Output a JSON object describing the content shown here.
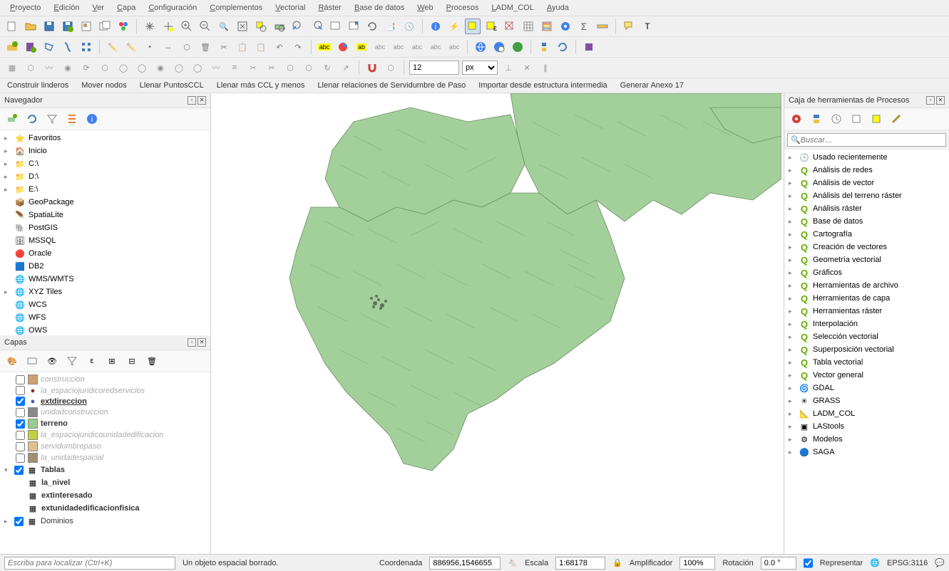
{
  "menu": [
    "Proyecto",
    "Edición",
    "Ver",
    "Capa",
    "Configuración",
    "Complementos",
    "Vectorial",
    "Ráster",
    "Base de datos",
    "Web",
    "Procesos",
    "LADM_COL",
    "Ayuda"
  ],
  "custom_toolbar": [
    "Construir linderos",
    "Mover nodos",
    "Llenar PuntosCCL",
    "Llenar más CCL y menos",
    "Llenar relaciones de Servidumbre de Paso",
    "Importar desde estructura intermedia",
    "Generar Anexo 17"
  ],
  "spin_value": "12",
  "unit": "px",
  "navigator": {
    "title": "Navegador",
    "items": [
      {
        "icon": "star",
        "label": "Favoritos",
        "color": "#f0c040",
        "expand": true
      },
      {
        "icon": "home",
        "label": "Inicio",
        "expand": true
      },
      {
        "icon": "drive",
        "label": "C:\\",
        "expand": true
      },
      {
        "icon": "drive",
        "label": "D:\\",
        "expand": true
      },
      {
        "icon": "drive",
        "label": "E:\\",
        "expand": true
      },
      {
        "icon": "gpkg",
        "label": "GeoPackage"
      },
      {
        "icon": "feather",
        "label": "SpatiaLite"
      },
      {
        "icon": "elephant",
        "label": "PostGIS"
      },
      {
        "icon": "mssql",
        "label": "MSSQL"
      },
      {
        "icon": "oracle",
        "label": "Oracle"
      },
      {
        "icon": "db2",
        "label": "DB2"
      },
      {
        "icon": "globe",
        "label": "WMS/WMTS"
      },
      {
        "icon": "globe",
        "label": "XYZ Tiles",
        "expand": true
      },
      {
        "icon": "globe",
        "label": "WCS"
      },
      {
        "icon": "globe",
        "label": "WFS"
      },
      {
        "icon": "globe",
        "label": "OWS"
      }
    ]
  },
  "layers": {
    "title": "Capas",
    "items": [
      {
        "checked": false,
        "swatch": "#d0a070",
        "label": "construccion",
        "inactive": true,
        "indent": 1,
        "type": "poly"
      },
      {
        "checked": false,
        "swatch": "#803030",
        "label": "la_espaciojuridicoredservicios",
        "inactive": true,
        "indent": 1,
        "type": "point"
      },
      {
        "checked": true,
        "swatch": "#4060a0",
        "label": "extdireccion",
        "bold": true,
        "under": true,
        "indent": 1,
        "type": "point"
      },
      {
        "checked": false,
        "swatch": "#888",
        "label": "unidadconstruccion",
        "inactive": true,
        "indent": 1,
        "type": "poly"
      },
      {
        "checked": true,
        "swatch": "#9cc98f",
        "label": "terreno",
        "bold": true,
        "indent": 1,
        "type": "poly"
      },
      {
        "checked": false,
        "swatch": "#c0d040",
        "label": "la_espaciojuridicounidadedificacion",
        "inactive": true,
        "indent": 1,
        "type": "poly"
      },
      {
        "checked": false,
        "swatch": "#e0c090",
        "label": "servidumbrepaso",
        "inactive": true,
        "indent": 1,
        "type": "poly"
      },
      {
        "checked": false,
        "swatch": "#a09070",
        "label": "la_unidadespacial",
        "inactive": true,
        "indent": 1,
        "type": "poly"
      },
      {
        "checked": true,
        "label": "Tablas",
        "bold": true,
        "indent": 0,
        "group": true,
        "expanded": true
      },
      {
        "label": "la_nivel",
        "bold": true,
        "indent": 2,
        "table": true
      },
      {
        "label": "extinteresado",
        "bold": true,
        "indent": 2,
        "table": true
      },
      {
        "label": "extunidadedificacionfisica",
        "bold": true,
        "indent": 2,
        "table": true
      },
      {
        "checked": true,
        "label": "Dominios",
        "indent": 0,
        "group": true,
        "expanded": false
      }
    ]
  },
  "processing": {
    "title": "Caja de herramientas de Procesos",
    "search_placeholder": "Buscar…",
    "items": [
      {
        "icon": "clock",
        "label": "Usado recientemente"
      },
      {
        "icon": "q",
        "label": "Análisis de redes"
      },
      {
        "icon": "q",
        "label": "Análisis de vector"
      },
      {
        "icon": "q",
        "label": "Análisis del terreno ráster"
      },
      {
        "icon": "q",
        "label": "Análisis ráster"
      },
      {
        "icon": "q",
        "label": "Base de datos"
      },
      {
        "icon": "q",
        "label": "Cartografía"
      },
      {
        "icon": "q",
        "label": "Creación de vectores"
      },
      {
        "icon": "q",
        "label": "Geometría vectorial"
      },
      {
        "icon": "q",
        "label": "Gráficos"
      },
      {
        "icon": "q",
        "label": "Herramientas de archivo"
      },
      {
        "icon": "q",
        "label": "Herramientas de capa"
      },
      {
        "icon": "q",
        "label": "Herramientas ráster"
      },
      {
        "icon": "q",
        "label": "Interpolación"
      },
      {
        "icon": "q",
        "label": "Selección vectorial"
      },
      {
        "icon": "q",
        "label": "Superposición vectorial"
      },
      {
        "icon": "q",
        "label": "Tabla vectorial"
      },
      {
        "icon": "q",
        "label": "Vector general"
      },
      {
        "icon": "gdal",
        "label": "GDAL"
      },
      {
        "icon": "grass",
        "label": "GRASS"
      },
      {
        "icon": "ladm",
        "label": "LADM_COL"
      },
      {
        "icon": "las",
        "label": "LAStools"
      },
      {
        "icon": "model",
        "label": "Modelos"
      },
      {
        "icon": "saga",
        "label": "SAGA"
      }
    ]
  },
  "status": {
    "locator_placeholder": "Escriba para localizar (Ctrl+K)",
    "message": "Un objeto espacial borrado.",
    "coord_label": "Coordenada",
    "coord_value": "886956,1546655",
    "scale_label": "Escala",
    "scale_value": "1:68178",
    "mag_label": "Amplificador",
    "mag_value": "100%",
    "rot_label": "Rotación",
    "rot_value": "0.0 °",
    "render_label": "Representar",
    "crs": "EPSG:3116"
  }
}
